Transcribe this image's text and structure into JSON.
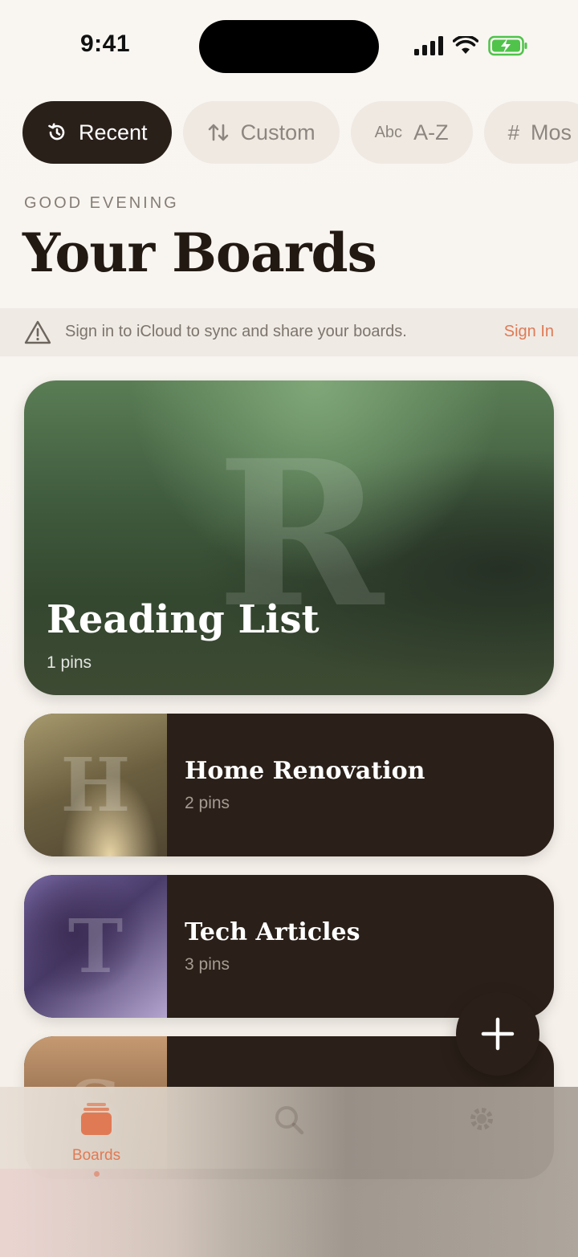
{
  "status_bar": {
    "time": "9:41"
  },
  "filters": [
    {
      "icon": "history-icon",
      "label": "Recent",
      "active": true
    },
    {
      "icon": "sort-arrows-icon",
      "label": "Custom",
      "active": false
    },
    {
      "icon": "abc-icon",
      "icon_text": "Abc",
      "label": "A-Z",
      "active": false
    },
    {
      "icon": "hash-icon",
      "icon_text": "#",
      "label": "Mos",
      "active": false
    }
  ],
  "header": {
    "greeting": "GOOD EVENING",
    "title": "Your Boards"
  },
  "banner": {
    "icon": "warning-icon",
    "message": "Sign in to iCloud to sync and share your boards.",
    "action": "Sign In"
  },
  "boards": [
    {
      "letter": "R",
      "name": "Reading List",
      "count": "1 pins",
      "color": "#4b6a46"
    },
    {
      "letter": "H",
      "name": "Home Renovation",
      "count": "2 pins",
      "color": "#8a7b55"
    },
    {
      "letter": "T",
      "name": "Tech Articles",
      "count": "3 pins",
      "color": "#6a5a8f"
    },
    {
      "letter": "S",
      "name": "",
      "count": "",
      "color": "#a27a58"
    }
  ],
  "fab": {
    "icon": "plus-icon"
  },
  "tabs": [
    {
      "icon": "boards-icon",
      "label": "Boards",
      "active": true
    },
    {
      "icon": "search-icon",
      "label": "",
      "active": false
    },
    {
      "icon": "gear-icon",
      "label": "",
      "active": false
    }
  ],
  "colors": {
    "accent": "#e07a55",
    "dark": "#2b2019",
    "background": "#f8f4ef"
  }
}
